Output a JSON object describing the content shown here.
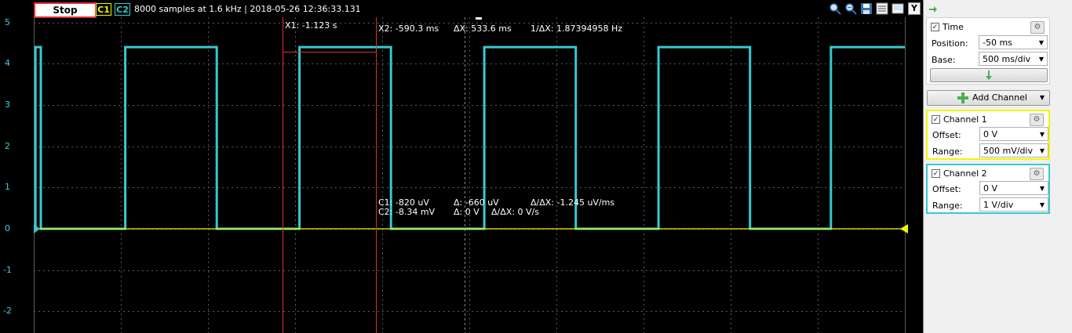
{
  "toolbar": {
    "stop_label": "Stop",
    "c1_label": "C1",
    "c2_label": "C2",
    "info": "8000 samples at 1.6 kHz | 2018-05-26 12:36:33.131",
    "y_button": "Y"
  },
  "axis": {
    "unit": "V",
    "labels": [
      "5",
      "4",
      "3",
      "2",
      "1",
      "0",
      "-1",
      "-2"
    ]
  },
  "cursors": {
    "x1": "X1: -1.123 s",
    "x2": "X2: -590.3 ms",
    "dx": "ΔX: 533.6 ms",
    "inv_dx": "1/ΔX: 1.87394958 Hz",
    "c1_val": "C1: -820 uV",
    "c1_delta": "Δ: -660 uV",
    "c1_slope": "Δ/ΔX: -1.245 uV/ms",
    "c2_val": "C2: -8.34 mV",
    "c2_delta": "Δ: 0 V",
    "c2_slope": "Δ/ΔX: 0 V/s"
  },
  "panel": {
    "time": {
      "title": "Time",
      "position_label": "Position:",
      "position_value": "-50 ms",
      "base_label": "Base:",
      "base_value": "500 ms/div"
    },
    "add_channel": "Add Channel",
    "channel1": {
      "title": "Channel 1",
      "offset_label": "Offset:",
      "offset_value": "0 V",
      "range_label": "Range:",
      "range_value": "500 mV/div"
    },
    "channel2": {
      "title": "Channel 2",
      "offset_label": "Offset:",
      "offset_value": "0 V",
      "range_label": "Range:",
      "range_value": "1 V/div"
    }
  },
  "colors": {
    "c1": "#f5f500",
    "c2": "#37c9d0",
    "cursor": "#e0302e",
    "grid": "#5a5a5a"
  },
  "chart_data": {
    "type": "line",
    "x_unit": "ms",
    "series": [
      {
        "name": "C1",
        "x": [
          -2450,
          2500
        ],
        "y": [
          0,
          0
        ]
      },
      {
        "name": "C2",
        "x": [
          -2450,
          -2440,
          -2440,
          -2410,
          -2410,
          -1930,
          -1930,
          -1410,
          -1410,
          -940,
          -940,
          -420,
          -420,
          110,
          110,
          630,
          630,
          1100,
          1100,
          1620,
          1620,
          2080,
          2080,
          2500
        ],
        "y": [
          0,
          0,
          4.4,
          4.4,
          0,
          0,
          4.4,
          4.4,
          0,
          0,
          4.4,
          4.4,
          0,
          0,
          4.4,
          4.4,
          0,
          0,
          4.4,
          4.4,
          0,
          0,
          4.4,
          4.4
        ]
      }
    ],
    "ylim": [
      -2.5,
      5.2
    ],
    "xlim": [
      -2450,
      2500
    ],
    "grid": true
  }
}
